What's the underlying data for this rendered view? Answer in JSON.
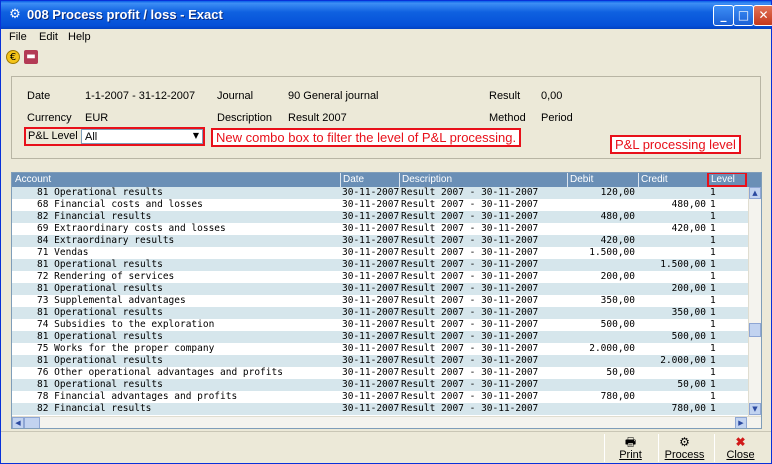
{
  "window": {
    "title": "008 Process profit / loss - Exact",
    "min": "_",
    "max": "□",
    "close": "✕"
  },
  "menu": [
    "File",
    "Edit",
    "Help"
  ],
  "filters": {
    "date_label": "Date",
    "date_value": "1-1-2007 - 31-12-2007",
    "journal_label": "Journal",
    "journal_value": "90 General journal",
    "result_label": "Result",
    "result_value": "0,00",
    "currency_label": "Currency",
    "currency_value": "EUR",
    "description_label": "Description",
    "description_value": "Result 2007",
    "method_label": "Method",
    "method_value": "Period",
    "pl_level_label": "P&L Level",
    "pl_level_value": "All"
  },
  "annotations": {
    "combo_note": "New combo box to filter the level of P&L processing.",
    "level_note": "P&L processing level"
  },
  "grid": {
    "headers": [
      "Account",
      "Date",
      "Description",
      "Debit",
      "Credit",
      "Level"
    ],
    "rows": [
      {
        "account": "81 Operational results",
        "date": "30-11-2007",
        "description": "Result 2007 - 30-11-2007",
        "debit": "120,00",
        "credit": "",
        "level": "1"
      },
      {
        "account": "68 Financial costs and losses",
        "date": "30-11-2007",
        "description": "Result 2007 - 30-11-2007",
        "debit": "",
        "credit": "480,00",
        "level": "1"
      },
      {
        "account": "82 Financial results",
        "date": "30-11-2007",
        "description": "Result 2007 - 30-11-2007",
        "debit": "480,00",
        "credit": "",
        "level": "1"
      },
      {
        "account": "69 Extraordinary costs and losses",
        "date": "30-11-2007",
        "description": "Result 2007 - 30-11-2007",
        "debit": "",
        "credit": "420,00",
        "level": "1"
      },
      {
        "account": "84 Extraordinary results",
        "date": "30-11-2007",
        "description": "Result 2007 - 30-11-2007",
        "debit": "420,00",
        "credit": "",
        "level": "1"
      },
      {
        "account": "71 Vendas",
        "date": "30-11-2007",
        "description": "Result 2007 - 30-11-2007",
        "debit": "1.500,00",
        "credit": "",
        "level": "1"
      },
      {
        "account": "81 Operational results",
        "date": "30-11-2007",
        "description": "Result 2007 - 30-11-2007",
        "debit": "",
        "credit": "1.500,00",
        "level": "1"
      },
      {
        "account": "72 Rendering of services",
        "date": "30-11-2007",
        "description": "Result 2007 - 30-11-2007",
        "debit": "200,00",
        "credit": "",
        "level": "1"
      },
      {
        "account": "81 Operational results",
        "date": "30-11-2007",
        "description": "Result 2007 - 30-11-2007",
        "debit": "",
        "credit": "200,00",
        "level": "1"
      },
      {
        "account": "73 Supplemental advantages",
        "date": "30-11-2007",
        "description": "Result 2007 - 30-11-2007",
        "debit": "350,00",
        "credit": "",
        "level": "1"
      },
      {
        "account": "81 Operational results",
        "date": "30-11-2007",
        "description": "Result 2007 - 30-11-2007",
        "debit": "",
        "credit": "350,00",
        "level": "1"
      },
      {
        "account": "74 Subsidies to the exploration",
        "date": "30-11-2007",
        "description": "Result 2007 - 30-11-2007",
        "debit": "500,00",
        "credit": "",
        "level": "1"
      },
      {
        "account": "81 Operational results",
        "date": "30-11-2007",
        "description": "Result 2007 - 30-11-2007",
        "debit": "",
        "credit": "500,00",
        "level": "1"
      },
      {
        "account": "75 Works for the proper company",
        "date": "30-11-2007",
        "description": "Result 2007 - 30-11-2007",
        "debit": "2.000,00",
        "credit": "",
        "level": "1"
      },
      {
        "account": "81 Operational results",
        "date": "30-11-2007",
        "description": "Result 2007 - 30-11-2007",
        "debit": "",
        "credit": "2.000,00",
        "level": "1"
      },
      {
        "account": "76 Other operational advantages and profits",
        "date": "30-11-2007",
        "description": "Result 2007 - 30-11-2007",
        "debit": "50,00",
        "credit": "",
        "level": "1"
      },
      {
        "account": "81 Operational results",
        "date": "30-11-2007",
        "description": "Result 2007 - 30-11-2007",
        "debit": "",
        "credit": "50,00",
        "level": "1"
      },
      {
        "account": "78 Financial advantages and profits",
        "date": "30-11-2007",
        "description": "Result 2007 - 30-11-2007",
        "debit": "780,00",
        "credit": "",
        "level": "1"
      },
      {
        "account": "82 Financial results",
        "date": "30-11-2007",
        "description": "Result 2007 - 30-11-2007",
        "debit": "",
        "credit": "780,00",
        "level": "1"
      }
    ]
  },
  "buttons": {
    "print": "Print",
    "process": "Process",
    "close": "Close"
  },
  "icons": {
    "app": "gear-icon",
    "euro": "euro-icon",
    "book": "book-icon",
    "print": "printer-icon",
    "process": "process-gears-icon",
    "close": "red-x-icon"
  }
}
